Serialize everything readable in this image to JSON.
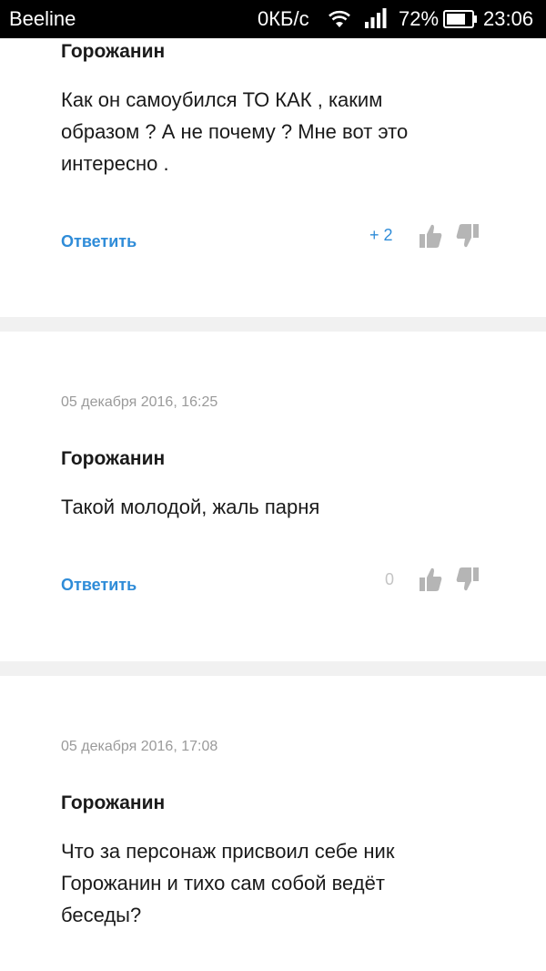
{
  "status_bar": {
    "carrier": "Beeline",
    "network_speed": "0КБ/с",
    "battery_percent": "72%",
    "time": "23:06",
    "icons": [
      "wifi-icon",
      "signal-icon",
      "battery-icon"
    ]
  },
  "colors": {
    "accent": "#2f8cd8",
    "text": "#1a1a1a",
    "muted": "#9a9a9a",
    "icon": "#b5b5b5",
    "separator": "#f1f1f1"
  },
  "comments": [
    {
      "author": "Горожанин",
      "text_lines": [
        "Как он самоубился ТО КАК , каким",
        "образом ? А не почему ? Мне вот это",
        "интересно ."
      ],
      "reply_label": "Ответить",
      "score": "+ 2"
    },
    {
      "date": "05 декабря 2016, 16:25",
      "author": "Горожанин",
      "text_lines": [
        "Такой молодой, жаль парня"
      ],
      "reply_label": "Ответить",
      "score": "0"
    },
    {
      "date": "05 декабря 2016, 17:08",
      "author": "Горожанин",
      "text_lines": [
        "Что за персонаж присвоил себе ник",
        "Горожанин и тихо сам собой ведёт",
        "беседы?"
      ]
    }
  ]
}
